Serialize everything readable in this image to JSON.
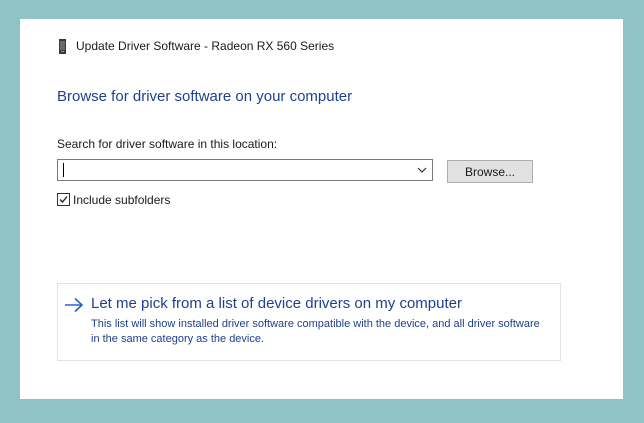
{
  "window": {
    "title": "Update Driver Software - Radeon RX 560 Series"
  },
  "page": {
    "heading": "Browse for driver software on your computer"
  },
  "search": {
    "label": "Search for driver software in this location:",
    "value": "",
    "placeholder": ""
  },
  "browse": {
    "label": "Browse..."
  },
  "include_subfolders": {
    "label": "Include subfolders",
    "checked": true
  },
  "pick_option": {
    "title": "Let me pick from a list of device drivers on my computer",
    "description": "This list will show installed driver software compatible with the device, and all driver software in the same category as the device."
  },
  "colors": {
    "background": "#8fc3c5",
    "heading_blue": "#1f3f8f",
    "link_arrow_blue": "#2563c9"
  },
  "icons": {
    "title_icon": "device-icon",
    "combo_dropdown": "chevron-down-icon",
    "checkbox_mark": "checkmark-icon",
    "pick_arrow": "arrow-right-icon"
  }
}
